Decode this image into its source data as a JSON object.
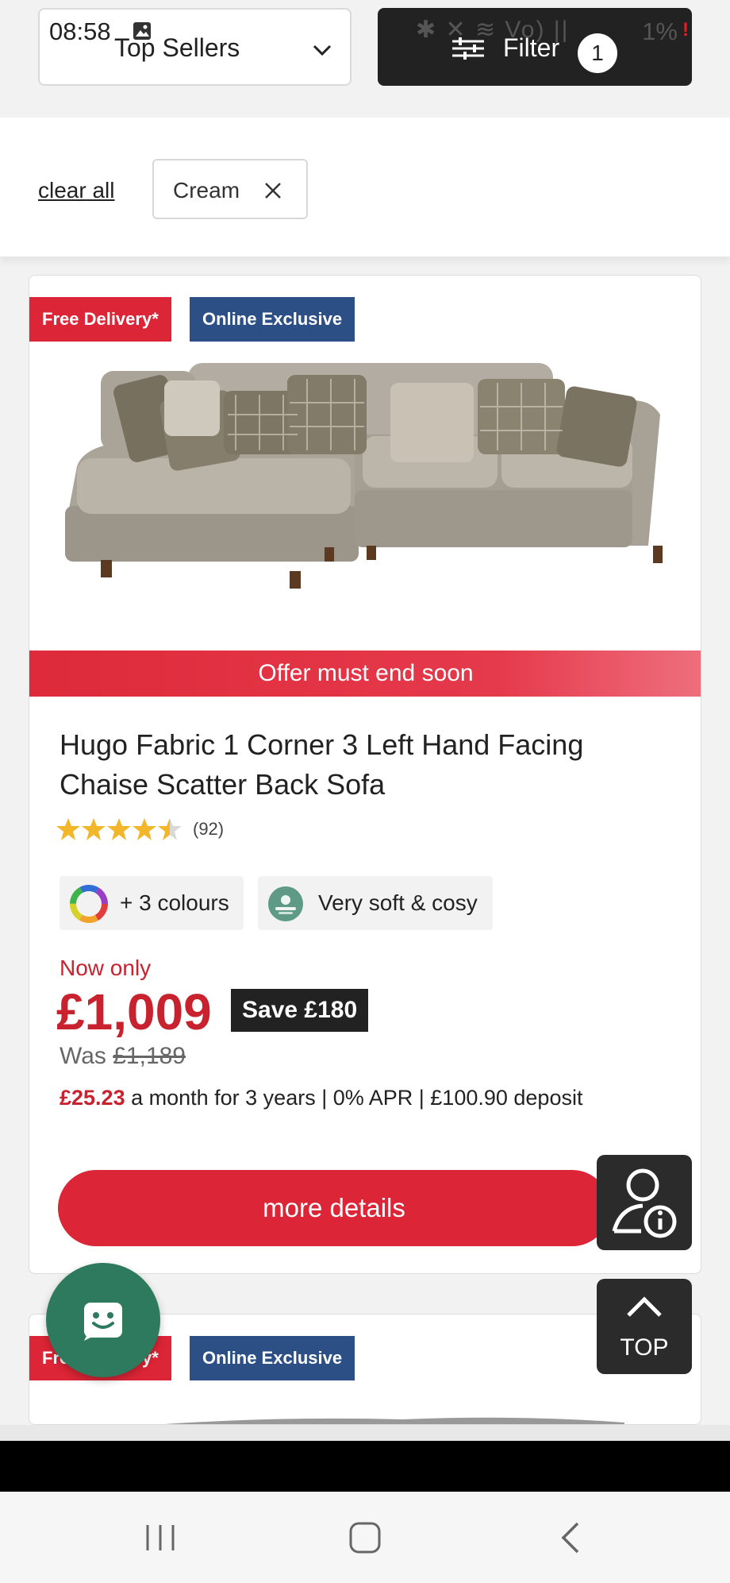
{
  "status_bar": {
    "time": "08:58",
    "right_icons": "✱ ✕ ≋ Vo) ||",
    "battery": "1%",
    "warning": "!"
  },
  "toolbar": {
    "sort_label": "Top Sellers",
    "filter_label": "Filter",
    "filter_count": "1"
  },
  "filters": {
    "clear_all": "clear all",
    "chips": [
      {
        "label": "Cream"
      }
    ]
  },
  "product": {
    "badges": [
      "Free Delivery*",
      "Online Exclusive"
    ],
    "offer_banner": "Offer must end soon",
    "title": "Hugo Fabric 1 Corner 3 Left Hand Facing Chaise Scatter Back Sofa",
    "rating": 4.5,
    "review_count": "(92)",
    "colours_label": "+ 3 colours",
    "comfort_label": "Very soft & cosy",
    "now_only": "Now only",
    "price": "£1,009",
    "save": "Save £180",
    "was_prefix": "Was",
    "was_price": "£1,189",
    "finance_amount": "£25.23",
    "finance_text": " a month for 3 years | 0% APR | £100.90 deposit",
    "cta": "more details"
  },
  "next_product": {
    "badges": [
      "Free Delivery*",
      "Online Exclusive"
    ]
  },
  "floating": {
    "top_label": "TOP"
  },
  "colors": {
    "brand_red": "#dc2536",
    "badge_blue": "#2c5086",
    "dark": "#222222",
    "chat_green": "#2e7a5e"
  }
}
